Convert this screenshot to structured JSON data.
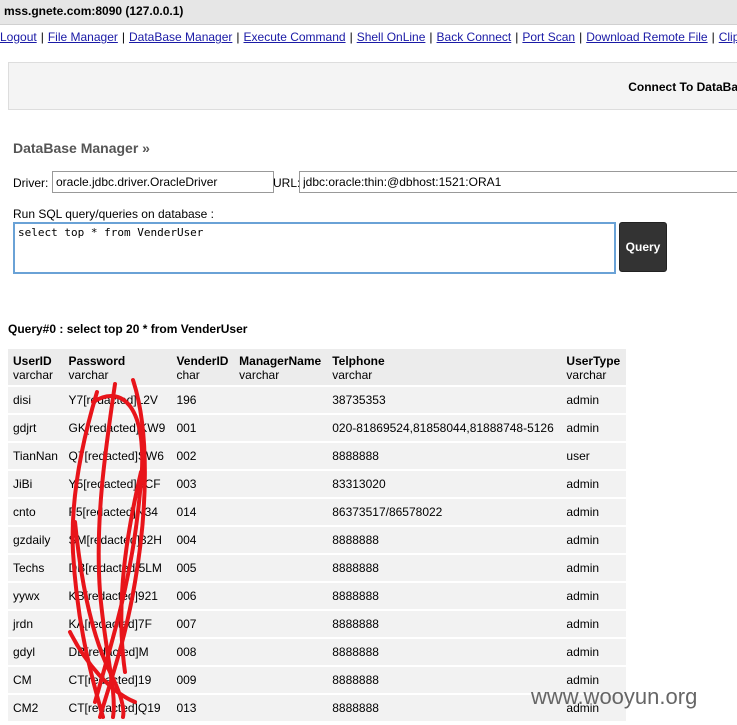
{
  "host": "mss.gnete.com:8090 (127.0.0.1)",
  "nav": [
    "Logout",
    "File Manager",
    "DataBase Manager",
    "Execute Command",
    "Shell OnLine",
    "Back Connect",
    "Port Scan",
    "Download Remote File",
    "ClipB"
  ],
  "panel_title": "Connect To DataBa",
  "section_title": "DataBase Manager »",
  "form": {
    "driver_label": "Driver:",
    "driver_value": "oracle.jdbc.driver.OracleDriver",
    "url_label": "URL:",
    "url_value": "jdbc:oracle:thin:@dbhost:1521:ORA1",
    "sql_label": "Run SQL query/queries on database :",
    "sql_value": "select top * from VenderUser",
    "query_button": "Query"
  },
  "query_heading": "Query#0 : select top 20 * from VenderUser",
  "table": {
    "columns": [
      {
        "name": "UserID",
        "type": "varchar"
      },
      {
        "name": "Password",
        "type": "varchar"
      },
      {
        "name": "VenderID",
        "type": "char"
      },
      {
        "name": "ManagerName",
        "type": "varchar"
      },
      {
        "name": "Telphone",
        "type": "varchar"
      },
      {
        "name": "UserType",
        "type": "varchar"
      }
    ],
    "rows": [
      [
        "disi",
        "Y7[redacted]L2V",
        "196",
        "",
        "38735353",
        "admin"
      ],
      [
        "gdjrt",
        "GK[redacted]KW9",
        "001",
        "",
        "020-81869524,81858044,81888748-5126",
        "admin"
      ],
      [
        "TianNan",
        "Q7[redacted]SW6",
        "002",
        "",
        "8888888",
        "user"
      ],
      [
        "JiBi",
        "Y5[redacted]BCF",
        "003",
        "",
        "83313020",
        "admin"
      ],
      [
        "cnto",
        "F5[redacted]N34",
        "014",
        "",
        "86373517/86578022",
        "admin"
      ],
      [
        "gzdaily",
        "SM[redacted]32H",
        "004",
        "",
        "8888888",
        "admin"
      ],
      [
        "Techs",
        "DB[redacted]5LM",
        "005",
        "",
        "8888888",
        "admin"
      ],
      [
        "yywx",
        "KB[redacted]921",
        "006",
        "",
        "8888888",
        "admin"
      ],
      [
        "jrdn",
        "KA[redacted]7F",
        "007",
        "",
        "8888888",
        "admin"
      ],
      [
        "gdyl",
        "DB[redacted]M",
        "008",
        "",
        "8888888",
        "admin"
      ],
      [
        "CM",
        "CT[redacted]19",
        "009",
        "",
        "8888888",
        "admin"
      ],
      [
        "CM2",
        "CT[redacted]Q19",
        "013",
        "",
        "8888888",
        "admin"
      ]
    ]
  },
  "watermark": "www.wooyun.org"
}
